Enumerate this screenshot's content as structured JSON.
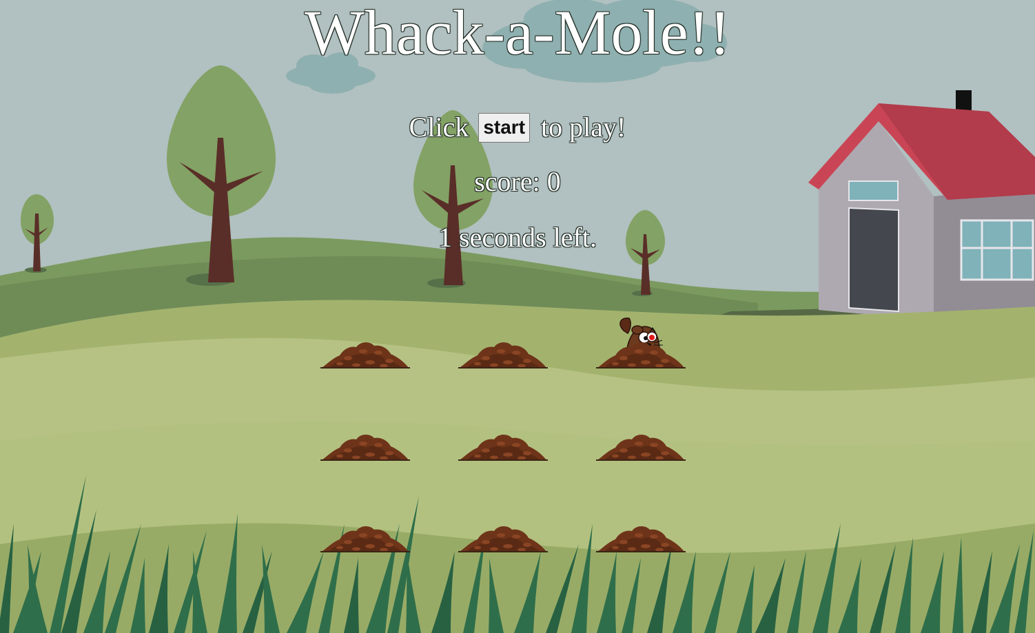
{
  "game": {
    "title": "Whack-a-Mole!!",
    "prompt_before": "Click",
    "start_label": "start",
    "prompt_after": "to play!",
    "score_label": "score:",
    "score_value": "0",
    "time_left": "1",
    "time_suffix": "seconds left."
  },
  "grid": {
    "rows": 3,
    "cols": 3,
    "active_hole": 3
  },
  "colors": {
    "sky": "#b1c0c0",
    "grass_light": "#b5c283",
    "grass_mid": "#a3b36e",
    "grass_dark": "#6f8c57",
    "dirt": "#6e3419",
    "roof": "#c94555",
    "house_wall": "#a9a4ab"
  }
}
